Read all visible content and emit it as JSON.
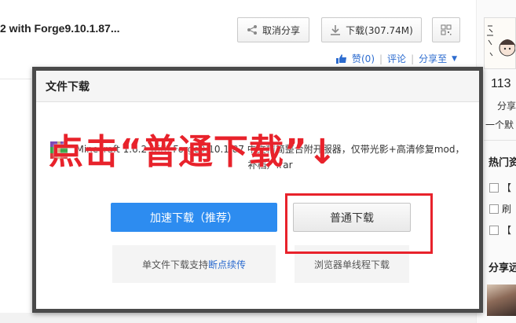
{
  "page": {
    "file_title": "2 with Forge9.10.1.87...",
    "buttons": {
      "unshare": "取消分享",
      "download": "下载(307.74M)"
    },
    "meta": {
      "like": "赞(0)",
      "comment": "评论",
      "share_to": "分享至"
    }
  },
  "sidebar": {
    "count": "113",
    "share": "分享",
    "default_text": "一个默",
    "hot_title": "热门资",
    "items": [
      "【",
      "刷",
      "【"
    ],
    "share_title": "分享远"
  },
  "dialog": {
    "title": "文件下载",
    "file_name_line1": "Minecraft 1.6.2 with Forge9.10.1.87 中文精简整合附开服器，仅带光影+高清修复mod，",
    "file_name_line2": "补档）.rar",
    "fast_download": "加速下载（推荐）",
    "normal_download": "普通下载",
    "fast_note_prefix": "单文件下载支持",
    "fast_note_highlight": "断点续传",
    "normal_note": "浏览器单线程下载"
  },
  "annotation": {
    "text": "点击“普通下载”↓",
    "color": "#e8222b"
  },
  "colors": {
    "accent_blue": "#2d8cf0",
    "link_blue": "#2d6ccf",
    "annotation_red": "#e8222b"
  }
}
